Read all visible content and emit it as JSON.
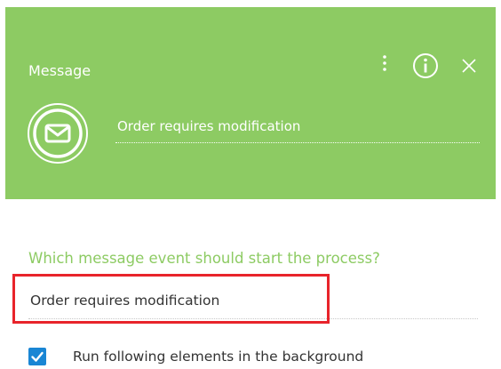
{
  "header": {
    "title": "Message",
    "background_color": "#8dcb63",
    "icons": {
      "menu": "vertical-dots-icon",
      "info": "info-icon",
      "close": "close-icon",
      "element": "envelope-icon"
    },
    "element_name": "Order requires modification"
  },
  "body": {
    "question": "Which message event should start the process?",
    "question_color": "#8dcb63",
    "message_value": "Order requires modification",
    "highlight_color": "#e8242b",
    "background_option": {
      "label": "Run following elements in the background",
      "checked": true,
      "checkbox_color": "#1a86d4"
    }
  }
}
